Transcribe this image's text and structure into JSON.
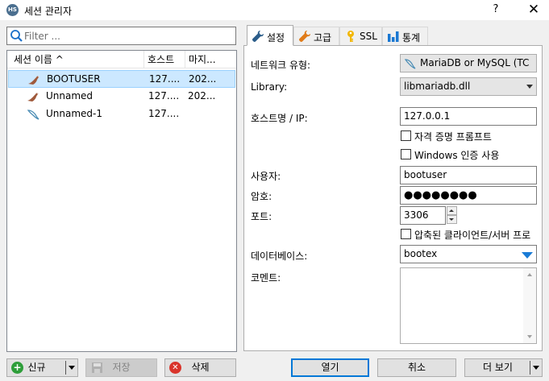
{
  "window": {
    "title": "세션 관리자",
    "icon_text": "HS",
    "help_label": "?",
    "close_label": "✕"
  },
  "filter": {
    "placeholder": "Filter ..."
  },
  "session_list": {
    "columns": [
      "세션 이름 ^",
      "호스트",
      "마지..."
    ],
    "rows": [
      {
        "name": "BOOTUSER",
        "host": "127....",
        "last": "202...",
        "icon": "mariadb-seal-icon",
        "selected": true
      },
      {
        "name": "Unnamed",
        "host": "127....",
        "last": "202...",
        "icon": "mariadb-seal-icon",
        "selected": false
      },
      {
        "name": "Unnamed-1",
        "host": "127....",
        "last": "",
        "icon": "mysql-dolphin-icon",
        "selected": false
      }
    ]
  },
  "tabs": [
    {
      "label": "설정",
      "icon": "wrench-icon",
      "active": true
    },
    {
      "label": "고급",
      "icon": "wrench-orange-icon",
      "active": false
    },
    {
      "label": "SSL",
      "icon": "key-icon",
      "active": false
    },
    {
      "label": "통계",
      "icon": "bar-chart-icon",
      "active": false
    }
  ],
  "settings": {
    "network_type_label": "네트워크 유형:",
    "network_type_value": "MariaDB or MySQL (TC",
    "library_label": "Library:",
    "library_value": "libmariadb.dll",
    "hostname_label": "호스트명 / IP:",
    "hostname_value": "127.0.0.1",
    "credential_prompt_label": "자격 증명 프롬프트",
    "windows_auth_label": "Windows 인증 사용",
    "user_label": "사용자:",
    "user_value": "bootuser",
    "password_label": "암호:",
    "password_value": "●●●●●●●●",
    "port_label": "포트:",
    "port_value": "3306",
    "compressed_label": "압축된 클라이언트/서버 프로",
    "database_label": "데이터베이스:",
    "database_value": "bootex",
    "comment_label": "코멘트:",
    "comment_value": ""
  },
  "buttons": {
    "new_label": "신규",
    "save_label": "저장",
    "delete_label": "삭제",
    "open_label": "열기",
    "cancel_label": "취소",
    "more_label": "더 보기"
  },
  "colors": {
    "selection": "#cce8ff",
    "accent": "#0078d7",
    "new_icon": "#2e9e3a",
    "delete_icon": "#d9342b",
    "dropdown_arrow": "#1a7bd6"
  }
}
